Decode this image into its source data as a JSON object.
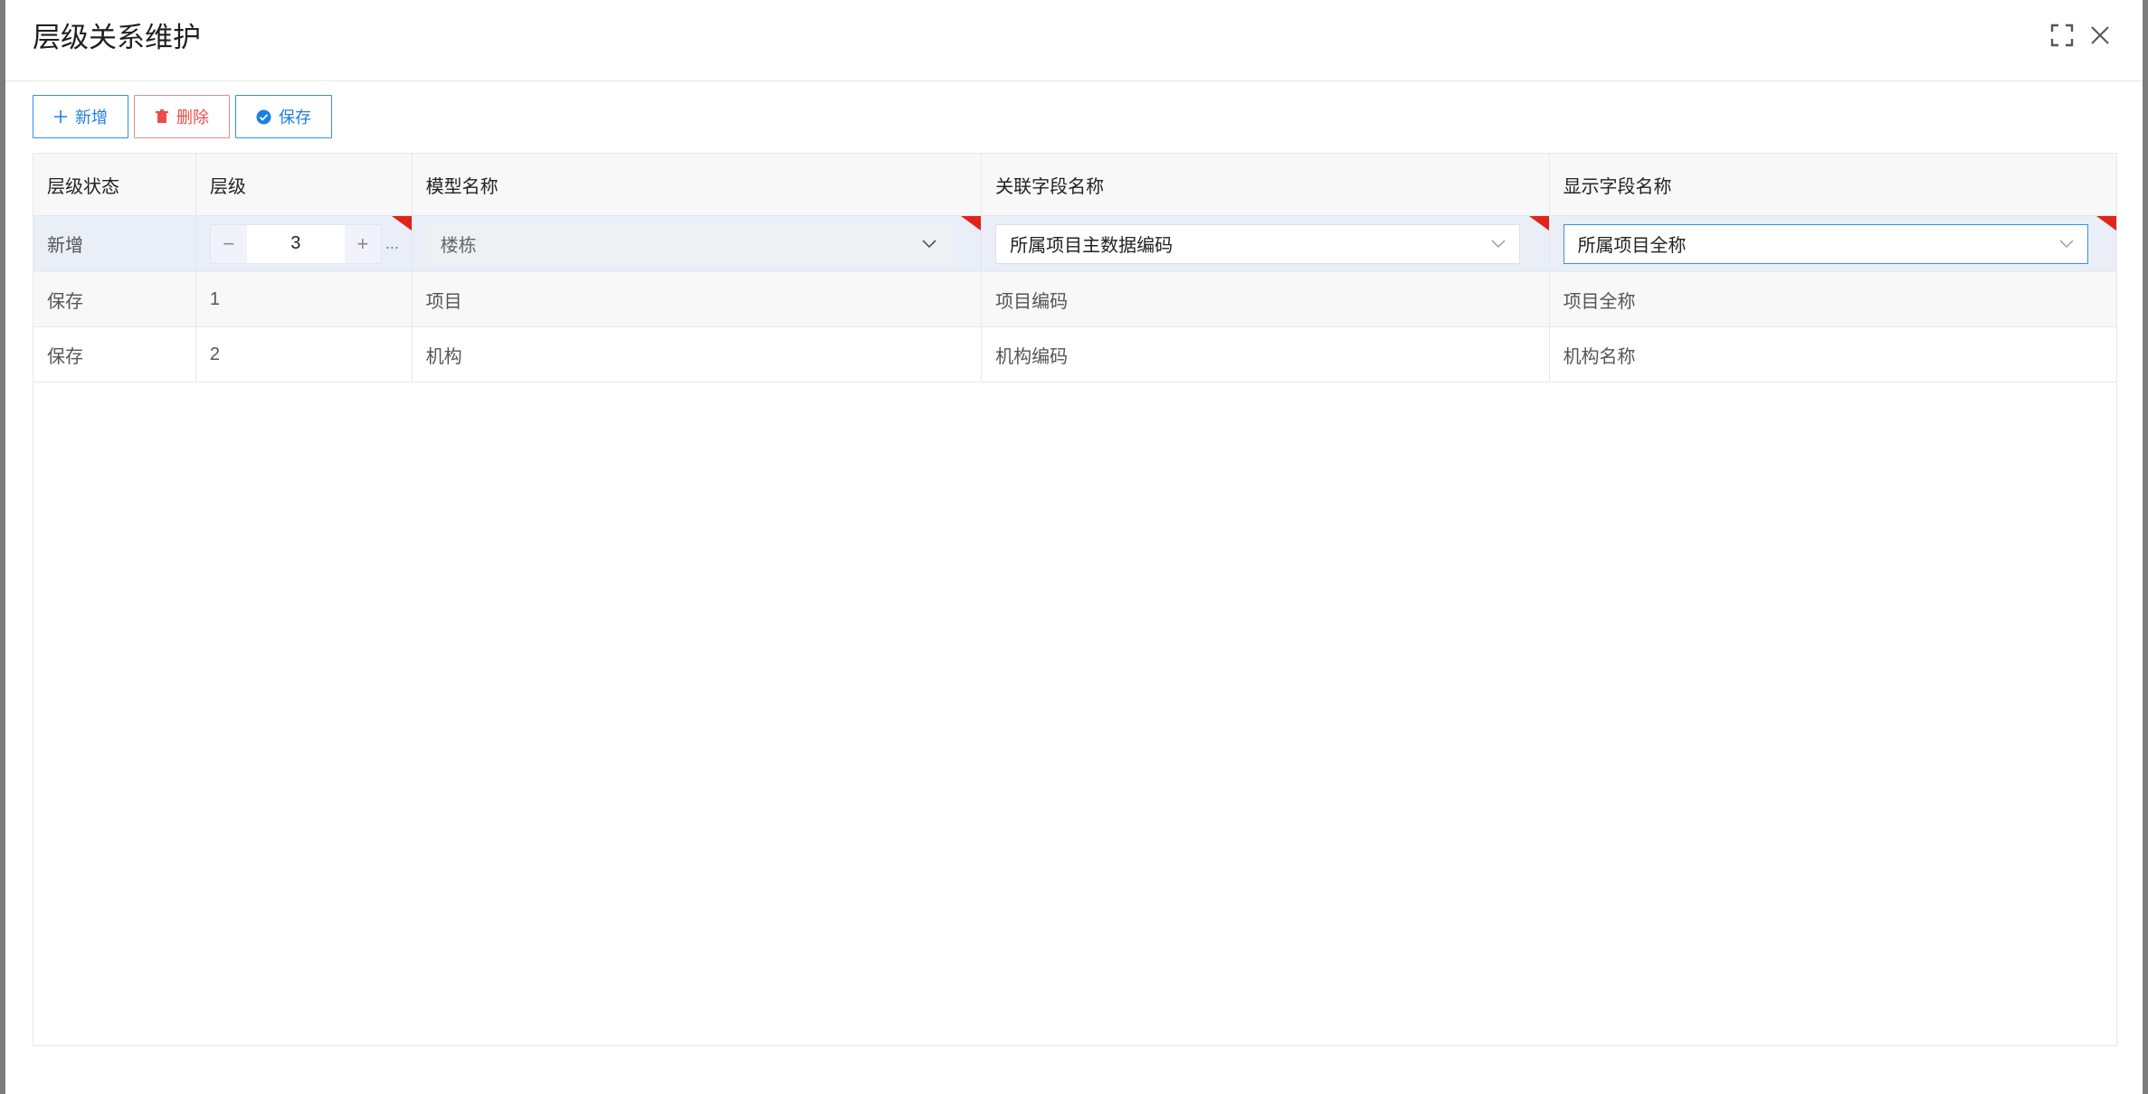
{
  "modal": {
    "title": "层级关系维护",
    "fullscreen_icon": "fullscreen-icon",
    "close_icon": "close-icon"
  },
  "toolbar": {
    "add_label": "新增",
    "delete_label": "删除",
    "save_label": "保存"
  },
  "table": {
    "columns": [
      "层级状态",
      "层级",
      "模型名称",
      "关联字段名称",
      "显示字段名称"
    ],
    "edit_row": {
      "status": "新增",
      "level": "3",
      "model_name": "楼栋",
      "link_field": "所属项目主数据编码",
      "display_field": "所属项目全称"
    },
    "rows": [
      {
        "status": "保存",
        "level": "1",
        "model_name": "项目",
        "link_field": "项目编码",
        "display_field": "项目全称"
      },
      {
        "status": "保存",
        "level": "2",
        "model_name": "机构",
        "link_field": "机构编码",
        "display_field": "机构名称"
      }
    ]
  },
  "colors": {
    "primary": "#2f8ff0",
    "danger": "#ee4b4b",
    "required_flag": "#e0241a"
  }
}
